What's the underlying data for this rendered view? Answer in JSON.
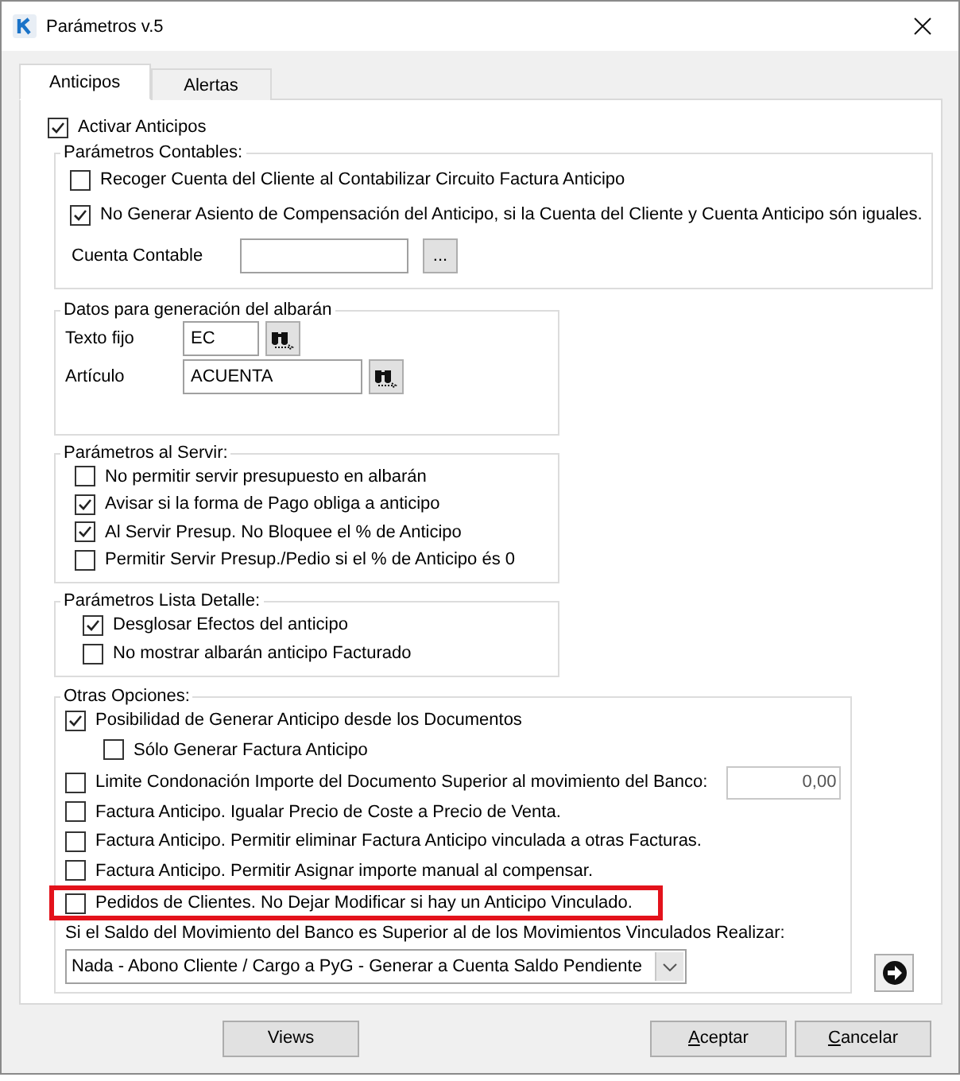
{
  "window": {
    "title": "Parámetros v.5"
  },
  "tabs": [
    {
      "label": "Anticipos",
      "selected": true
    },
    {
      "label": "Alertas",
      "selected": false
    }
  ],
  "activar": {
    "label": "Activar Anticipos",
    "checked": true
  },
  "contables": {
    "title": "Parámetros Contables:",
    "options": [
      {
        "label": "Recoger Cuenta del Cliente al Contabilizar Circuito Factura Anticipo",
        "checked": false
      },
      {
        "label": "No Generar Asiento de Compensación del Anticipo, si la Cuenta del Cliente y Cuenta Anticipo són iguales.",
        "checked": true
      }
    ],
    "cuenta_label": "Cuenta Contable",
    "browse": "..."
  },
  "albaran": {
    "title": "Datos para generación del albarán",
    "fields": [
      {
        "label": "Texto fijo",
        "value": "EC"
      },
      {
        "label": "Artículo",
        "value": "ACUENTA"
      }
    ]
  },
  "servir": {
    "title": "Parámetros al Servir:",
    "options": [
      {
        "label": "No permitir servir presupuesto en albarán",
        "checked": false
      },
      {
        "label": "Avisar si la forma de Pago obliga a anticipo",
        "checked": true
      },
      {
        "label": "Al Servir Presup. No Bloquee el % de Anticipo",
        "checked": true
      },
      {
        "label": "Permitir Servir Presup./Pedio si el % de Anticipo és 0",
        "checked": false
      }
    ]
  },
  "lista": {
    "title": "Parámetros Lista Detalle:",
    "options": [
      {
        "label": "Desglosar Efectos del anticipo",
        "checked": true
      },
      {
        "label": "No mostrar albarán anticipo Facturado",
        "checked": false
      }
    ]
  },
  "otras": {
    "title": "Otras Opciones:",
    "options": [
      {
        "label": "Posibilidad de Generar Anticipo desde los Documentos",
        "checked": true,
        "children": [
          {
            "label": "Sólo Generar Factura Anticipo",
            "checked": false
          }
        ]
      },
      {
        "label": "Limite Condonación Importe del Documento Superior al movimiento del Banco:",
        "checked": false,
        "field": {
          "value": "0,00",
          "disabled": true
        }
      },
      {
        "label": "Factura Anticipo. Igualar Precio de Coste a Precio de Venta.",
        "checked": false
      },
      {
        "label": "Factura Anticipo. Permitir eliminar Factura Anticipo vinculada a otras Facturas.",
        "checked": false
      },
      {
        "label": "Factura Anticipo. Permitir Asignar importe manual al compensar.",
        "checked": false
      },
      {
        "label": "Pedidos de Clientes. No Dejar Modificar si hay un Anticipo Vinculado.",
        "checked": false,
        "highlighted": true
      }
    ],
    "saldo_label": "Si el Saldo del Movimiento del Banco es Superior al de los Movimientos Vinculados Realizar:",
    "saldo_value": "Nada - Abono Cliente / Cargo a PyG - Generar a Cuenta Saldo Pendiente"
  },
  "buttons": {
    "views": "Views",
    "actions": [
      {
        "label": "Aceptar",
        "mnemonic_underlined": true
      },
      {
        "label": "Cancelar",
        "mnemonic_underlined": true
      }
    ]
  }
}
